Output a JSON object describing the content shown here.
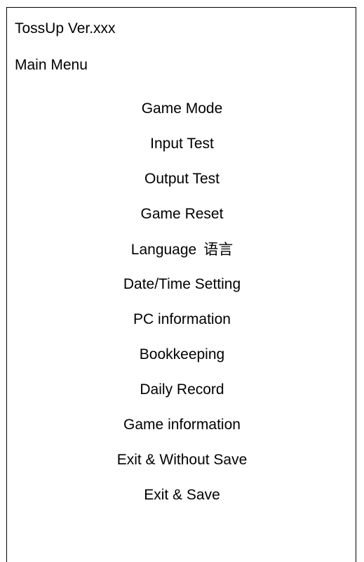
{
  "app": {
    "title": "TossUp Ver.xxx"
  },
  "menu": {
    "title": "Main Menu",
    "items": [
      {
        "label": "Game Mode"
      },
      {
        "label": "Input Test"
      },
      {
        "label": "Output Test"
      },
      {
        "label": "Game Reset"
      },
      {
        "label": "Language",
        "suffix": "语言"
      },
      {
        "label": "Date/Time Setting"
      },
      {
        "label": "PC information"
      },
      {
        "label": "Bookkeeping"
      },
      {
        "label": "Daily Record"
      },
      {
        "label": "Game information"
      },
      {
        "label": "Exit & Without Save"
      },
      {
        "label": "Exit & Save"
      }
    ]
  }
}
